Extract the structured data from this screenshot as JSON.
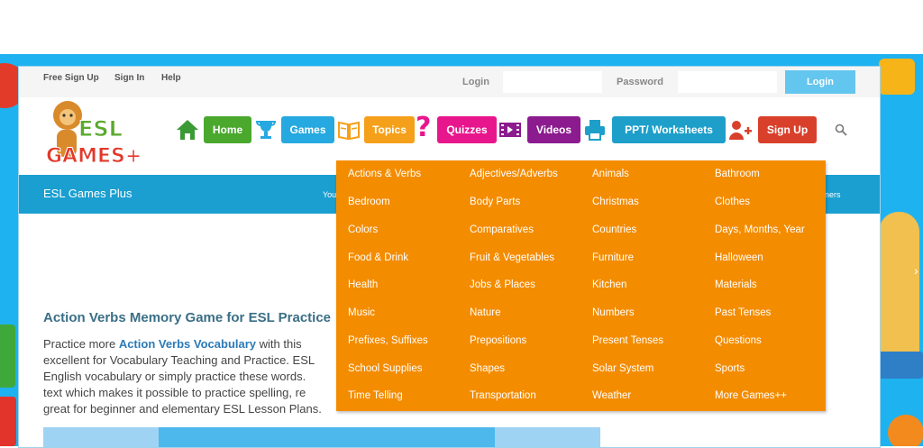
{
  "topbar": {
    "links": [
      "Free Sign Up",
      "Sign In",
      "Help"
    ],
    "login_label": "Login",
    "password_label": "Password",
    "login_button": "Login"
  },
  "logo": {
    "line1": "ESL",
    "line2": "GAMES+"
  },
  "nav": {
    "home": "Home",
    "games": "Games",
    "topics": "Topics",
    "quizzes": "Quizzes",
    "videos": "Videos",
    "ppt": "PPT/ Worksheets",
    "signup": "Sign Up"
  },
  "bar": {
    "site_name": "ESL Games Plus",
    "frag_left": "You",
    "frag_right": "ners"
  },
  "content": {
    "heading": "Action Verbs Memory Game for ESL Practice",
    "para": {
      "l1_prefix": "Practice more ",
      "l1_link": "Action Verbs Vocabulary",
      "l1_suffix": " with this",
      "l2": "excellent for Vocabulary Teaching and Practice. ESL",
      "l3": "English vocabulary or simply practice these words.",
      "l4": "text which makes it possible to practice spelling, re",
      "l5": "great for beginner and elementary ESL Lesson Plans."
    }
  },
  "topics_menu": {
    "columns": [
      [
        "Actions & Verbs",
        "Bedroom",
        "Colors",
        "Food & Drink",
        "Health",
        "Music",
        "Prefixes, Suffixes",
        "School Supplies",
        "Time Telling"
      ],
      [
        "Adjectives/Adverbs",
        "Body Parts",
        "Comparatives",
        "Fruit & Vegetables",
        "Jobs & Places",
        "Nature",
        "Prepositions",
        "Shapes",
        "Transportation"
      ],
      [
        "Animals",
        "Christmas",
        "Countries",
        "Furniture",
        "Kitchen",
        "Numbers",
        "Present Tenses",
        "Solar System",
        "Weather"
      ],
      [
        "Bathroom",
        "Clothes",
        "Days, Months, Year",
        "Halloween",
        "Materials",
        "Past Tenses",
        "Questions",
        "Sports",
        "More Games++"
      ]
    ]
  },
  "colors": {
    "home": "#4aa82d",
    "games": "#26a9e0",
    "topics": "#f5a01a",
    "quizzes": "#e8168c",
    "videos": "#8b1b8f",
    "ppt": "#1e9fc9",
    "signup": "#d9402b",
    "menu": "#f48c00",
    "bluebar": "#1a9fd0"
  },
  "icons": [
    "house-icon",
    "trophy-icon",
    "book-icon",
    "question-mark-icon",
    "film-icon",
    "printer-icon",
    "add-user-icon",
    "search-icon"
  ]
}
